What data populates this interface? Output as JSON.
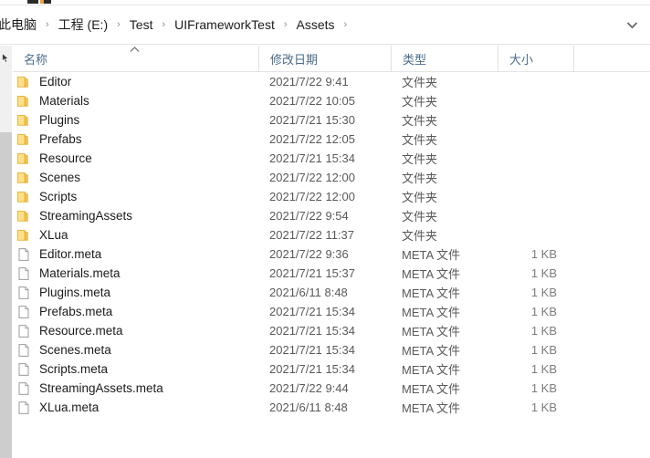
{
  "window": {
    "type": "windows-file-explorer",
    "accent_folder_color": "#ffdd77",
    "header_text_color": "#4a6b8a",
    "body_text_color": "#1b1b1b",
    "muted_text_color": "#595959"
  },
  "address_bar": {
    "breadcrumb": [
      "此电脑",
      "工程 (E:)",
      "Test",
      "UIFrameworkTest",
      "Assets"
    ],
    "separator": "›",
    "trailing_separator": "›",
    "dropdown_icon": "chevron-down-icon"
  },
  "columns": {
    "name": "名称",
    "date_modified": "修改日期",
    "type": "类型",
    "size": "大小",
    "sort_indicator": "caret-up-icon",
    "sorted_by": "名称",
    "sort_direction": "ascending"
  },
  "files": [
    {
      "name": "Editor",
      "date": "2021/7/22 9:41",
      "type": "文件夹",
      "size": "",
      "icon": "folder-icon"
    },
    {
      "name": "Materials",
      "date": "2021/7/22 10:05",
      "type": "文件夹",
      "size": "",
      "icon": "folder-icon"
    },
    {
      "name": "Plugins",
      "date": "2021/7/21 15:30",
      "type": "文件夹",
      "size": "",
      "icon": "folder-icon"
    },
    {
      "name": "Prefabs",
      "date": "2021/7/22 12:05",
      "type": "文件夹",
      "size": "",
      "icon": "folder-icon"
    },
    {
      "name": "Resource",
      "date": "2021/7/21 15:34",
      "type": "文件夹",
      "size": "",
      "icon": "folder-icon"
    },
    {
      "name": "Scenes",
      "date": "2021/7/22 12:00",
      "type": "文件夹",
      "size": "",
      "icon": "folder-icon"
    },
    {
      "name": "Scripts",
      "date": "2021/7/22 12:00",
      "type": "文件夹",
      "size": "",
      "icon": "folder-icon"
    },
    {
      "name": "StreamingAssets",
      "date": "2021/7/22 9:54",
      "type": "文件夹",
      "size": "",
      "icon": "folder-icon"
    },
    {
      "name": "XLua",
      "date": "2021/7/22 11:37",
      "type": "文件夹",
      "size": "",
      "icon": "folder-icon"
    },
    {
      "name": "Editor.meta",
      "date": "2021/7/22 9:36",
      "type": "META 文件",
      "size": "1 KB",
      "icon": "file-icon"
    },
    {
      "name": "Materials.meta",
      "date": "2021/7/21 15:37",
      "type": "META 文件",
      "size": "1 KB",
      "icon": "file-icon"
    },
    {
      "name": "Plugins.meta",
      "date": "2021/6/11 8:48",
      "type": "META 文件",
      "size": "1 KB",
      "icon": "file-icon"
    },
    {
      "name": "Prefabs.meta",
      "date": "2021/7/21 15:34",
      "type": "META 文件",
      "size": "1 KB",
      "icon": "file-icon"
    },
    {
      "name": "Resource.meta",
      "date": "2021/7/21 15:34",
      "type": "META 文件",
      "size": "1 KB",
      "icon": "file-icon"
    },
    {
      "name": "Scenes.meta",
      "date": "2021/7/21 15:34",
      "type": "META 文件",
      "size": "1 KB",
      "icon": "file-icon"
    },
    {
      "name": "Scripts.meta",
      "date": "2021/7/21 15:34",
      "type": "META 文件",
      "size": "1 KB",
      "icon": "file-icon"
    },
    {
      "name": "StreamingAssets.meta",
      "date": "2021/7/22 9:44",
      "type": "META 文件",
      "size": "1 KB",
      "icon": "file-icon"
    },
    {
      "name": "XLua.meta",
      "date": "2021/6/11 8:48",
      "type": "META 文件",
      "size": "1 KB",
      "icon": "file-icon"
    }
  ],
  "navigation_scrollbar": {
    "orientation": "vertical",
    "thumb_position": "top"
  }
}
